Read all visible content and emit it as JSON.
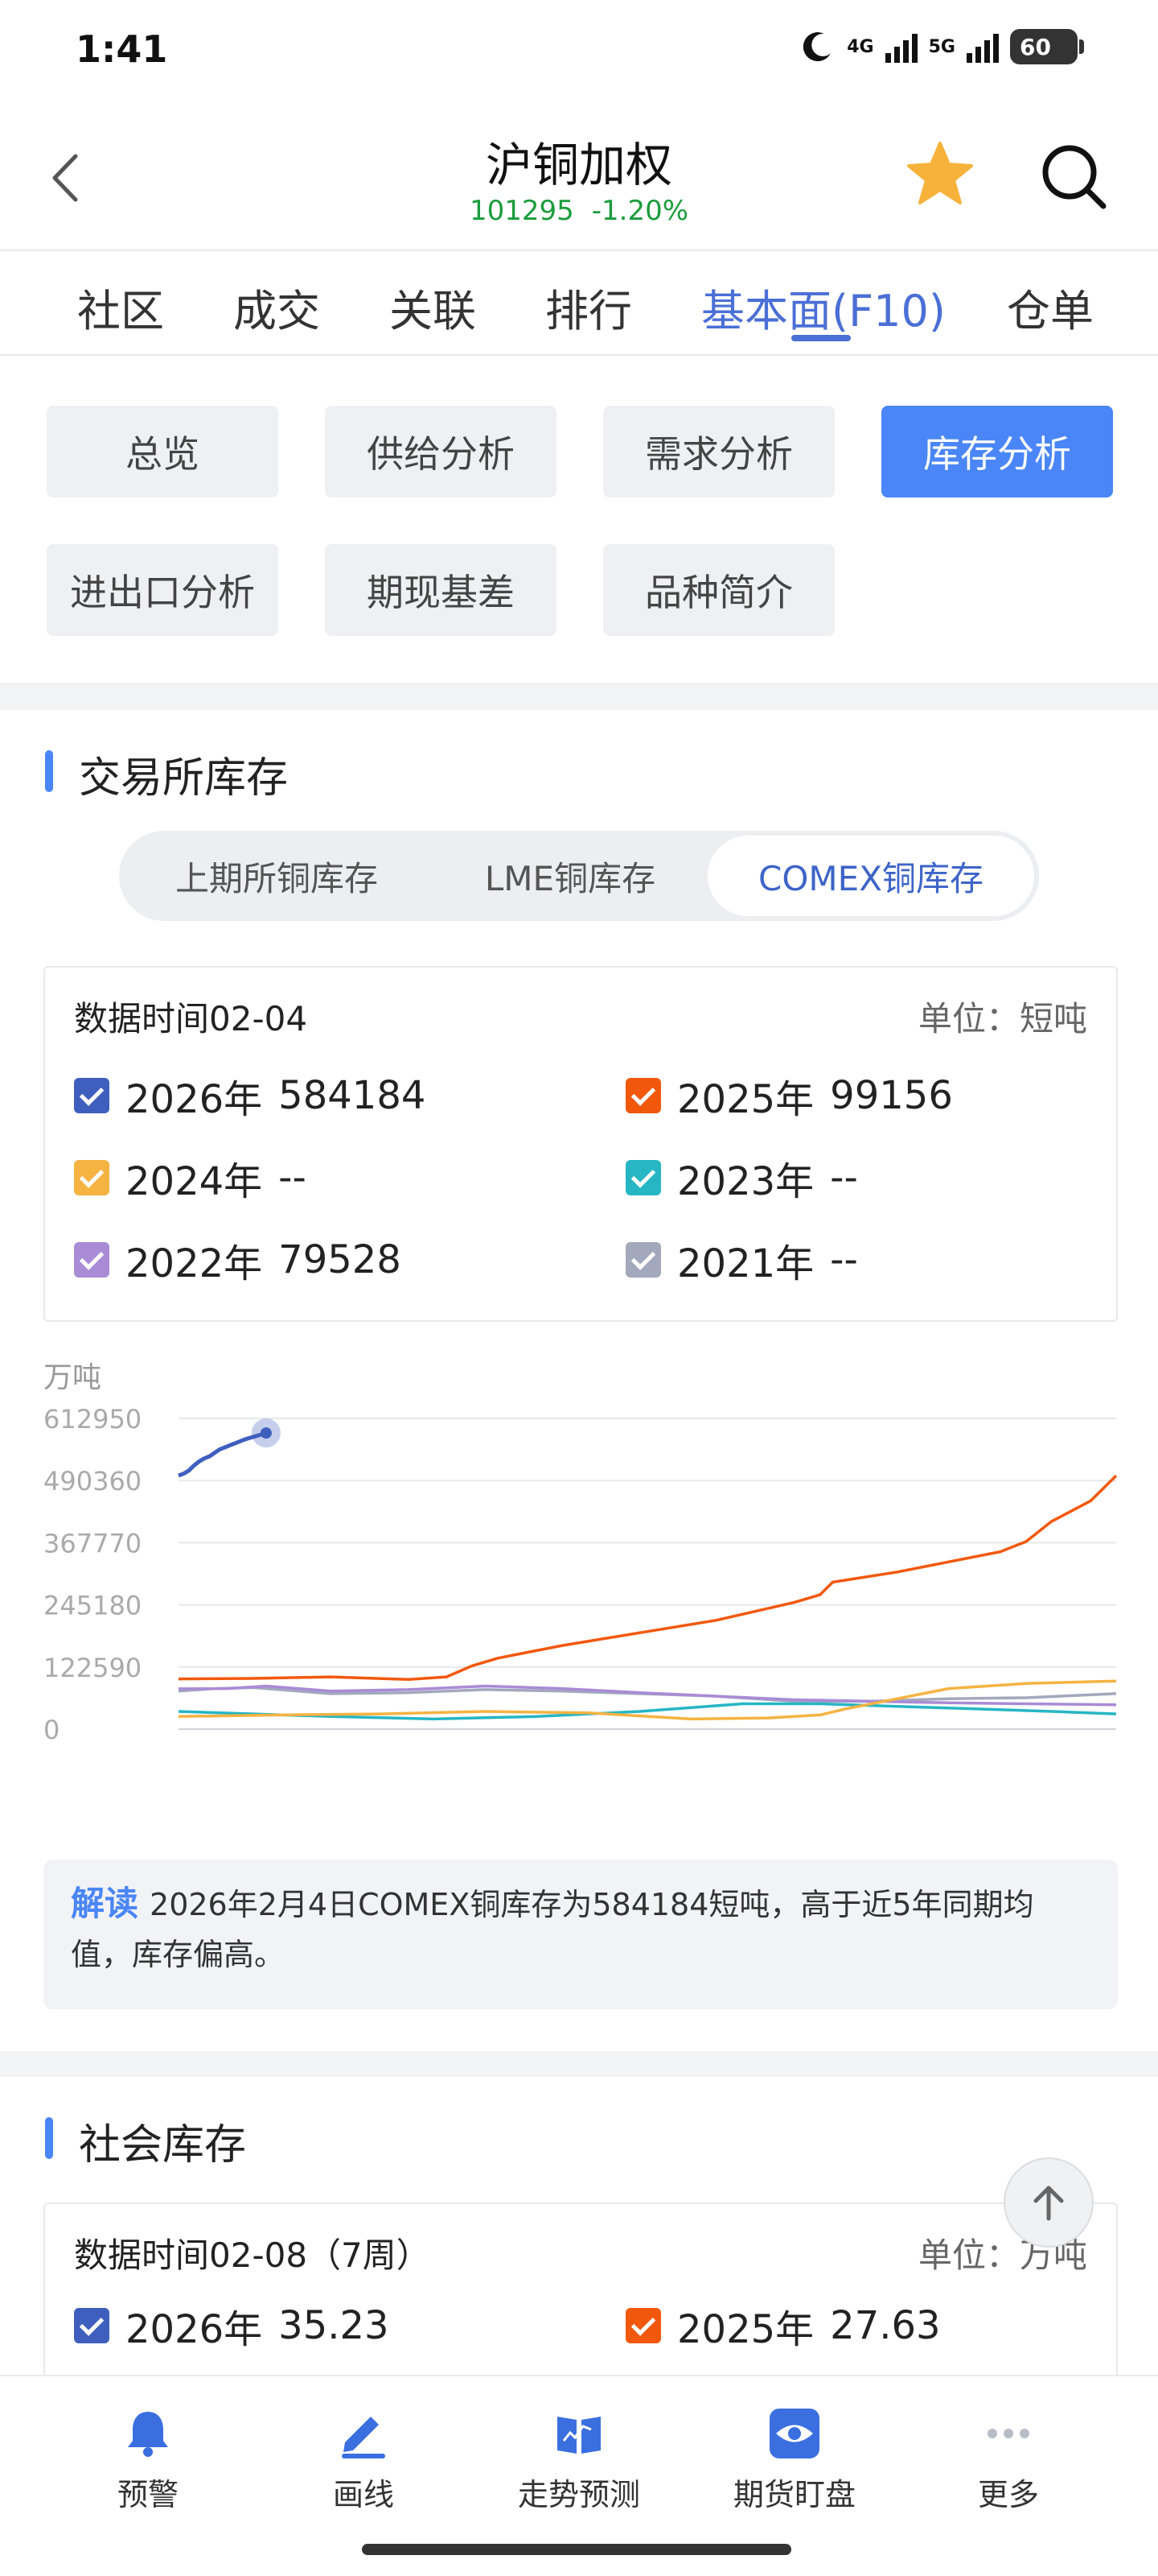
{
  "status_bar": {
    "time": "1:41",
    "net_4g": "4G",
    "net_5g": "5G",
    "battery": "60"
  },
  "header": {
    "title": "沪铜加权",
    "price": "101295",
    "change": "-1.20%"
  },
  "tabs": [
    "社区",
    "成交",
    "关联",
    "排行",
    "基本面(F10)",
    "仓单"
  ],
  "active_tab": "基本面(F10)",
  "sub_buttons": [
    "总览",
    "供给分析",
    "需求分析",
    "库存分析",
    "进出口分析",
    "期现基差",
    "品种简介"
  ],
  "active_sub_button": "库存分析",
  "exchange_section": {
    "title": "交易所库存",
    "segments": [
      "上期所铜库存",
      "LME铜库存",
      "COMEX铜库存"
    ],
    "active_segment": "COMEX铜库存",
    "data_time": "数据时间02-04",
    "unit": "单位：短吨",
    "legend": [
      {
        "year": "2026年",
        "value": "584184",
        "color": "#3f5fbf"
      },
      {
        "year": "2025年",
        "value": "99156",
        "color": "#f2580c"
      },
      {
        "year": "2024年",
        "value": "--",
        "color": "#f5b342"
      },
      {
        "year": "2023年",
        "value": "--",
        "color": "#26b6c4"
      },
      {
        "year": "2022年",
        "value": "79528",
        "color": "#a98bd6"
      },
      {
        "year": "2021年",
        "value": "--",
        "color": "#a3a8bd"
      }
    ],
    "chart_unit": "万吨",
    "interp_tag": "解读",
    "interp_text": "2026年2月4日COMEX铜库存为584184短吨，高于近5年同期均值，库存偏高。"
  },
  "chart_data": {
    "type": "line",
    "xlabel": "",
    "ylabel": "万吨",
    "x_range": [
      "01-02",
      "12-31"
    ],
    "ylim": [
      0,
      612950
    ],
    "y_ticks": [
      612950,
      490360,
      367770,
      245180,
      122590,
      0
    ],
    "grid": true,
    "series": [
      {
        "name": "2026年",
        "color": "#3f5fbf",
        "x": [
          1,
          3,
          5,
          7,
          9,
          11,
          13,
          15,
          17,
          19,
          21,
          23,
          25,
          27,
          29,
          31,
          33,
          35
        ],
        "y": [
          500000,
          504000,
          510000,
          520000,
          528000,
          534000,
          538000,
          545000,
          552000,
          556000,
          560000,
          564000,
          568000,
          572000,
          575000,
          578000,
          581000,
          584184
        ]
      },
      {
        "name": "2025年",
        "color": "#f2580c",
        "x": [
          1,
          30,
          60,
          90,
          105,
          115,
          125,
          150,
          180,
          210,
          240,
          250,
          255,
          280,
          300,
          320,
          330,
          340,
          355,
          365
        ],
        "y": [
          99156,
          100000,
          103000,
          98000,
          103000,
          125000,
          140000,
          165000,
          190000,
          215000,
          250000,
          265000,
          290000,
          310000,
          330000,
          350000,
          370000,
          410000,
          450000,
          500000
        ]
      },
      {
        "name": "2024年",
        "color": "#f5b342",
        "x": [
          1,
          40,
          80,
          120,
          160,
          200,
          230,
          250,
          260,
          280,
          300,
          330,
          365
        ],
        "y": [
          25000,
          28000,
          30000,
          35000,
          32000,
          20000,
          22000,
          28000,
          40000,
          60000,
          80000,
          90000,
          95000
        ]
      },
      {
        "name": "2023年",
        "color": "#26b6c4",
        "x": [
          1,
          30,
          60,
          100,
          140,
          180,
          220,
          250,
          280,
          310,
          340,
          365
        ],
        "y": [
          35000,
          30000,
          25000,
          20000,
          25000,
          35000,
          50000,
          50000,
          45000,
          40000,
          35000,
          30000
        ]
      },
      {
        "name": "2022年",
        "color": "#a98bd6",
        "x": [
          1,
          20,
          35,
          60,
          90,
          120,
          150,
          180,
          210,
          240,
          270,
          300,
          330,
          365
        ],
        "y": [
          79528,
          80000,
          85000,
          75000,
          78000,
          85000,
          80000,
          72000,
          65000,
          58000,
          55000,
          52000,
          50000,
          48000
        ]
      },
      {
        "name": "2021年",
        "color": "#a3a8bd",
        "x": [
          1,
          15,
          30,
          60,
          90,
          120,
          150,
          180,
          210,
          240,
          270,
          300,
          330,
          365
        ],
        "y": [
          75000,
          80000,
          82000,
          70000,
          72000,
          78000,
          75000,
          70000,
          65000,
          55000,
          55000,
          60000,
          62000,
          70000
        ]
      }
    ]
  },
  "social_section": {
    "title": "社会库存",
    "data_time": "数据时间02-08（7周）",
    "unit": "单位：万吨",
    "legend": [
      {
        "year": "2026年",
        "value": "35.23",
        "color": "#3f5fbf"
      },
      {
        "year": "2025年",
        "value": "27.63",
        "color": "#f2580c"
      }
    ]
  },
  "bottom_nav": [
    {
      "label": "预警",
      "icon": "bell-icon"
    },
    {
      "label": "画线",
      "icon": "draw-line-icon"
    },
    {
      "label": "走势预测",
      "icon": "book-icon"
    },
    {
      "label": "期货盯盘",
      "icon": "eye-icon"
    },
    {
      "label": "更多",
      "icon": "more-icon"
    }
  ],
  "colors": {
    "accent": "#4a86f7",
    "tab_active": "#4a6fd6",
    "rise": "#1a9c3c"
  }
}
